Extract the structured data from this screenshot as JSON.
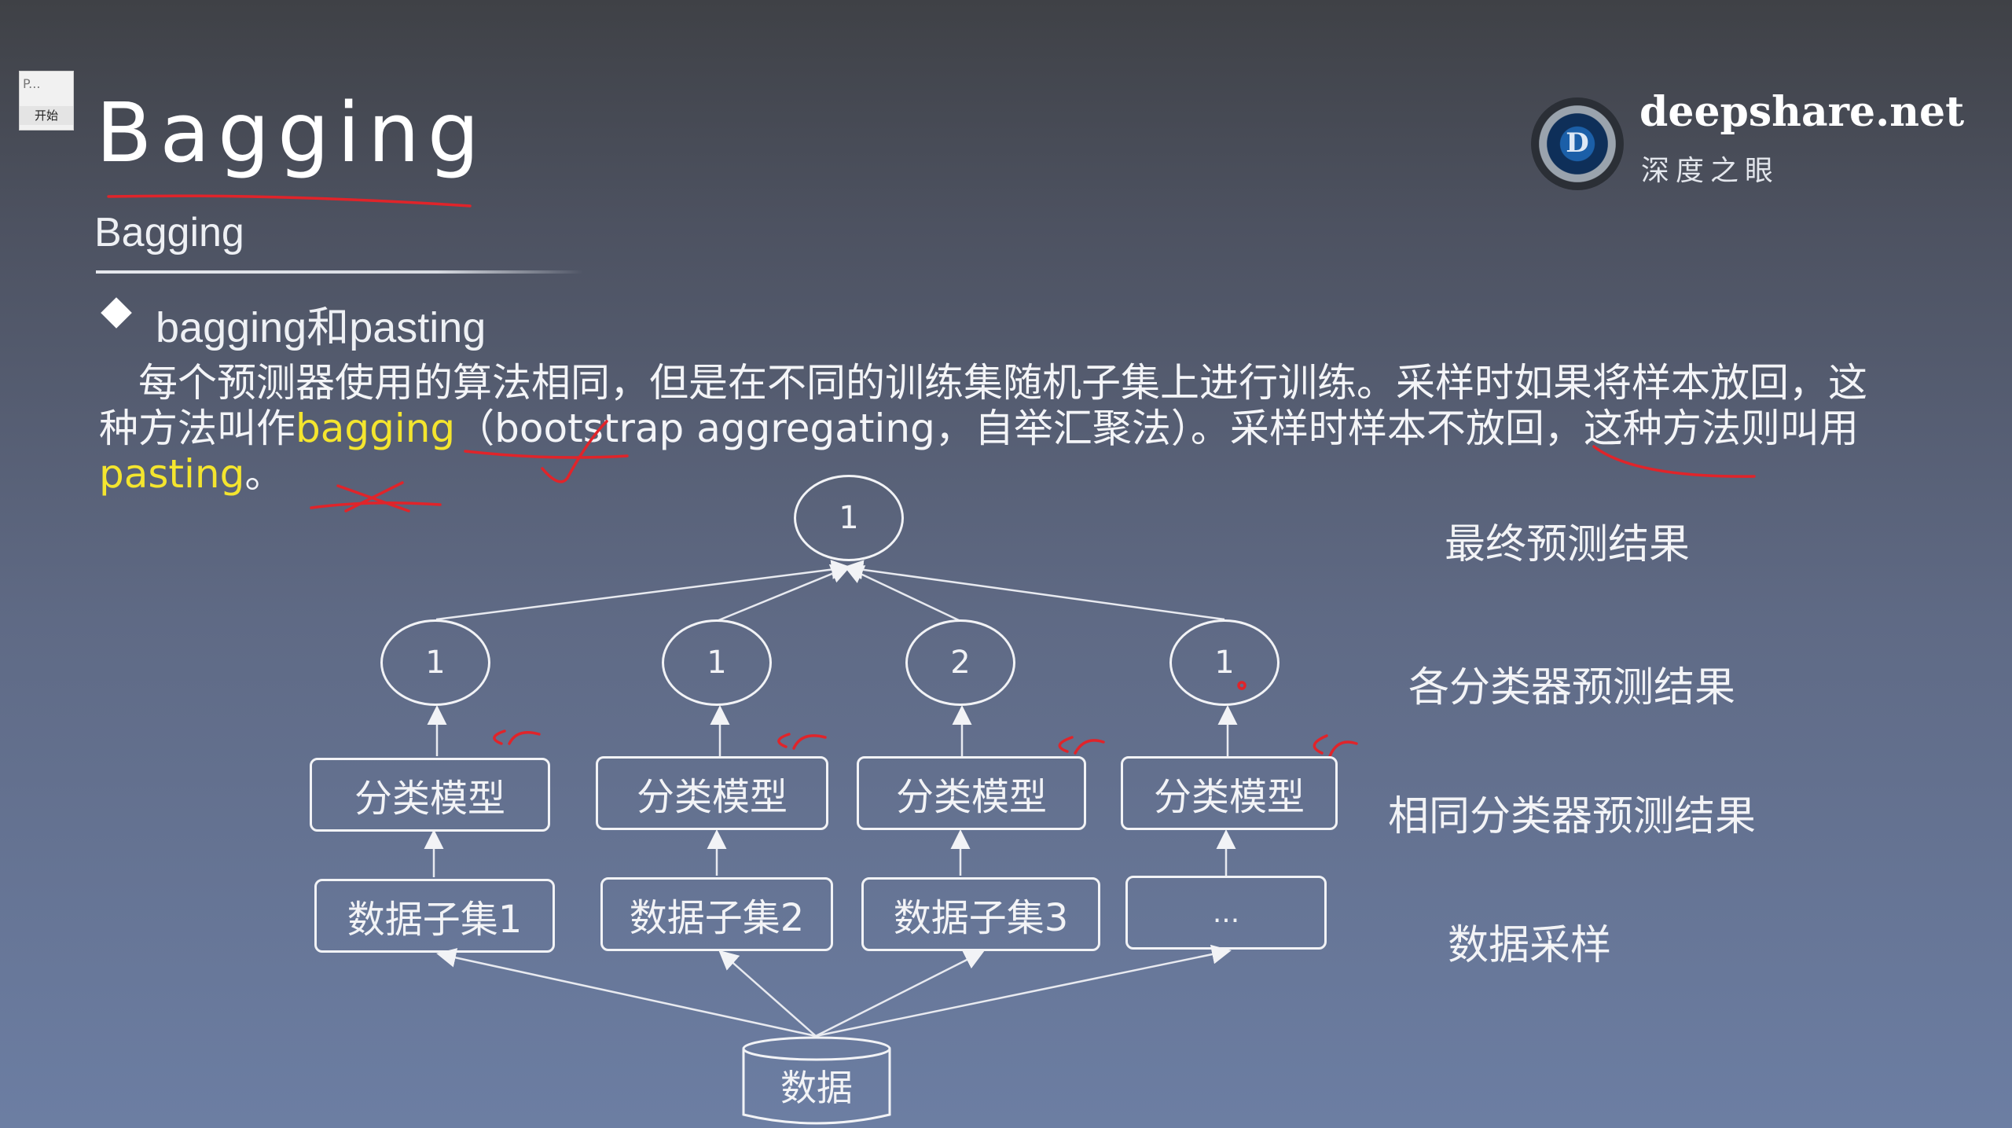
{
  "thumbnail": {
    "text": "P...",
    "button": "开始"
  },
  "title": "Bagging",
  "subtitle": "Bagging",
  "logo": {
    "letter": "D",
    "brand": "deepshare.net",
    "brand_cn": "深度之眼"
  },
  "bullet": "bagging和pasting",
  "paragraph": {
    "part1": "　每个预测器使用的算法相同，但是在不同的训练集随机子集上进行训练。采样时如果将样本放回，这种方法叫作",
    "bagging": "bagging",
    "part2": "（bootstrap aggregating，自举汇聚法）。采样时样本不放回，这种方法则叫用",
    "pasting": "pasting",
    "part3": "。"
  },
  "diagram": {
    "final_node": "1",
    "classifier_results": [
      "1",
      "1",
      "2",
      "1"
    ],
    "models": [
      "分类模型",
      "分类模型",
      "分类模型",
      "分类模型"
    ],
    "subsets": [
      "数据子集1",
      "数据子集2",
      "数据子集3",
      "..."
    ],
    "data": "数据",
    "labels": {
      "final": "最终预测结果",
      "each": "各分类器预测结果",
      "same": "相同分类器预测结果",
      "sampling": "数据采样"
    }
  },
  "annotations": {
    "handwritten_mark": "cr"
  }
}
